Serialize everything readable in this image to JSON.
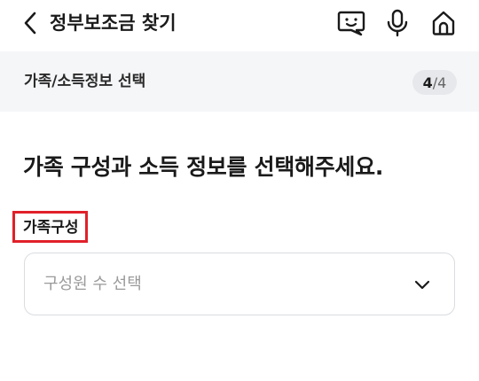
{
  "header": {
    "title": "정부보조금 찾기",
    "icons": [
      "back-arrow-icon",
      "chatbot-icon",
      "microphone-icon",
      "home-icon"
    ]
  },
  "step": {
    "title": "가족/소득정보 선택",
    "current": "4",
    "separator": "/",
    "total": "4"
  },
  "main": {
    "question": "가족 구성과 소득 정보를 선택해주세요.",
    "field_label": "가족구성",
    "select_placeholder": "구성원 수 선택"
  },
  "colors": {
    "highlight": "#e0202a",
    "step_bar_bg": "#f5f6f8",
    "placeholder": "#9a9a9a"
  }
}
